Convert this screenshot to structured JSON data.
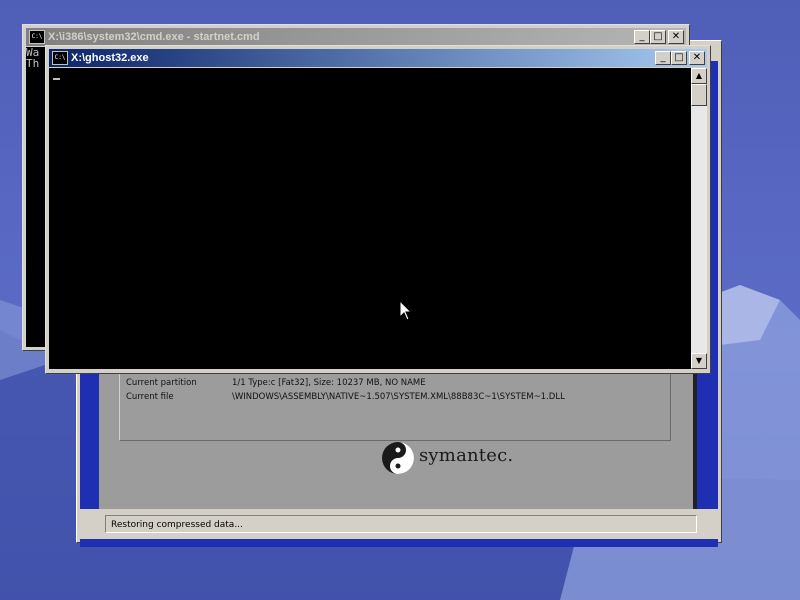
{
  "desktop": {
    "colors": {
      "sky": "#5868c2",
      "mountain": "#7d8fd6"
    }
  },
  "ghost": {
    "details": [
      {
        "label": "Current partition",
        "value": "1/1 Type:c [Fat32], Size: 10237 MB, NO NAME"
      },
      {
        "label": "Current file",
        "value": "\\WINDOWS\\ASSEMBLY\\NATIVE~1.507\\SYSTEM.XML\\88B83C~1\\SYSTEM~1.DLL"
      }
    ],
    "brand": "symantec.",
    "status": "Restoring compressed data..."
  },
  "cmd_back": {
    "title": "X:\\i386\\system32\\cmd.exe - startnet.cmd",
    "icon": "console-icon",
    "lines": [
      "Wa",
      "Th"
    ]
  },
  "cmd_front": {
    "title": "X:\\ghost32.exe",
    "icon": "console-icon",
    "buttons": {
      "minimize": "_",
      "maximize": "□",
      "close": "✕"
    }
  }
}
